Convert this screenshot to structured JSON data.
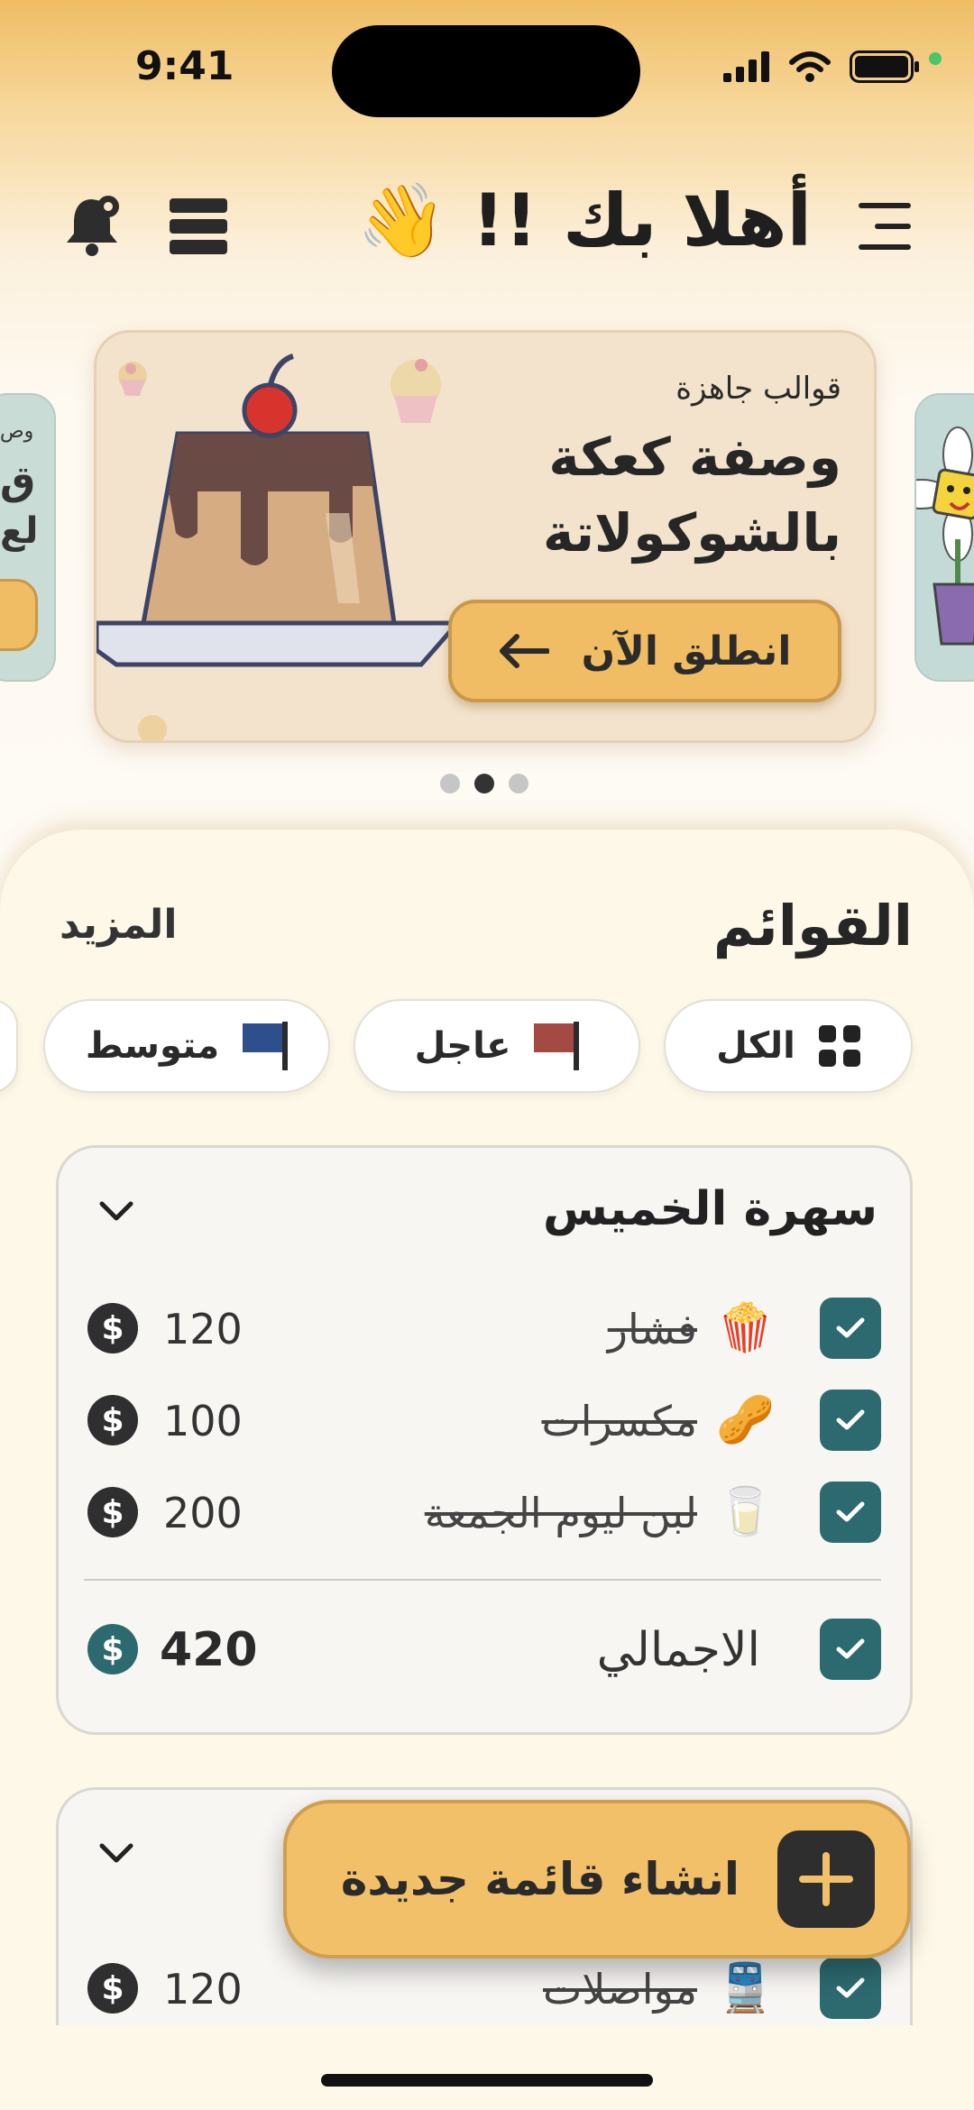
{
  "status_bar": {
    "time": "9:41"
  },
  "header": {
    "greeting": "أهلا بك !! 👋"
  },
  "carousel": {
    "eyebrow": "قوالب جاهزة",
    "title": "وصفة كعكة بالشوكولاتة",
    "button_label": "انطلق الآن",
    "pages": 3,
    "active_page": 2,
    "left_peek_lines": [
      "وص",
      "ق",
      "لع"
    ]
  },
  "lists": {
    "title": "القوائم",
    "more_label": "المزيد",
    "filters": [
      {
        "label": "الكل",
        "icon": "grid-icon"
      },
      {
        "label": "عاجل",
        "icon": "flag-icon",
        "color": "#a54a43"
      },
      {
        "label": "متوسط",
        "icon": "flag-icon",
        "color": "#2e4f8c"
      }
    ]
  },
  "list_card_1": {
    "title": "سهرة الخميس",
    "items": [
      {
        "emoji": "🍿",
        "name": "فشار",
        "price": "120",
        "checked": true
      },
      {
        "emoji": "🥜",
        "name": "مكسرات",
        "price": "100",
        "checked": true
      },
      {
        "emoji": "🥛",
        "name": "لبن ليوم الجمعة",
        "price": "200",
        "checked": true
      }
    ],
    "total_label": "الاجمالي",
    "total_value": "420",
    "currency_symbol": "$"
  },
  "list_card_2": {
    "items": [
      {
        "emoji": "🚆",
        "name": "مواصلات",
        "price": "120",
        "checked": true
      }
    ]
  },
  "fab": {
    "label": "انشاء قائمة جديدة"
  },
  "colors": {
    "accent": "#f1bd64",
    "teal": "#2d6a70",
    "dark": "#2e2e2e"
  }
}
